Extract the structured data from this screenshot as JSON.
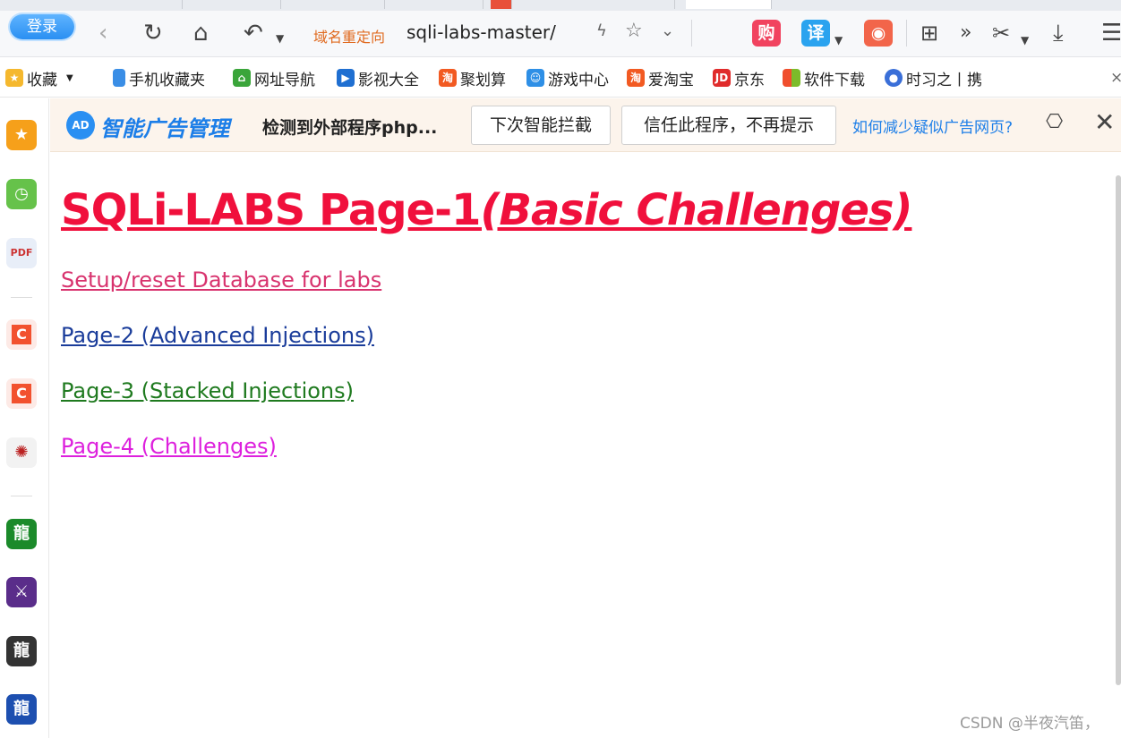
{
  "toolbar": {
    "login_label": "登录",
    "address": {
      "redirect_label": "域名重定向",
      "url": "sqli-labs-master/"
    }
  },
  "bookmarks": [
    {
      "label": "收藏",
      "icon": "star-icon",
      "color": "#f5b82e"
    },
    {
      "label": "手机收藏夹",
      "icon": "phone-icon",
      "color": "#3a8ee6"
    },
    {
      "label": "网址导航",
      "icon": "house-icon",
      "color": "#3aa53a"
    },
    {
      "label": "影视大全",
      "icon": "film-icon",
      "color": "#1f6fd1"
    },
    {
      "label": "聚划算",
      "icon": "taobao-icon",
      "color": "#f25a22"
    },
    {
      "label": "游戏中心",
      "icon": "game-icon",
      "color": "#2e8fe6"
    },
    {
      "label": "爱淘宝",
      "icon": "taobao-icon",
      "color": "#f25a22"
    },
    {
      "label": "京东",
      "icon": "jd-icon",
      "color": "#e02b2b"
    },
    {
      "label": "软件下载",
      "icon": "windows-icon",
      "color": "#4cae4c"
    },
    {
      "label": "时习之丨携",
      "icon": "badge-icon",
      "color": "#3a6fd8"
    }
  ],
  "adbar": {
    "logo_text": "AD",
    "title": "智能广告管理",
    "message": "检测到外部程序php...",
    "btn_next": "下次智能拦截",
    "btn_trust": "信任此程序，不再提示",
    "help_link": "如何减少疑似广告网页?"
  },
  "main": {
    "title_main": "SQLi-LABS Page-1",
    "title_sub": "(Basic Challenges)",
    "links": {
      "setup": "Setup/reset Database for labs",
      "page2": "Page-2 (Advanced Injections)",
      "page3": "Page-3 (Stacked Injections)",
      "page4": "Page-4 (Challenges)"
    }
  },
  "watermark": "CSDN @半夜汽笛，",
  "colors": {
    "title": "#f0103c",
    "setup_link": "#d8336e",
    "page2_link": "#1a3c9a",
    "page3_link": "#1f7a1f",
    "page4_link": "#dd20dd"
  }
}
